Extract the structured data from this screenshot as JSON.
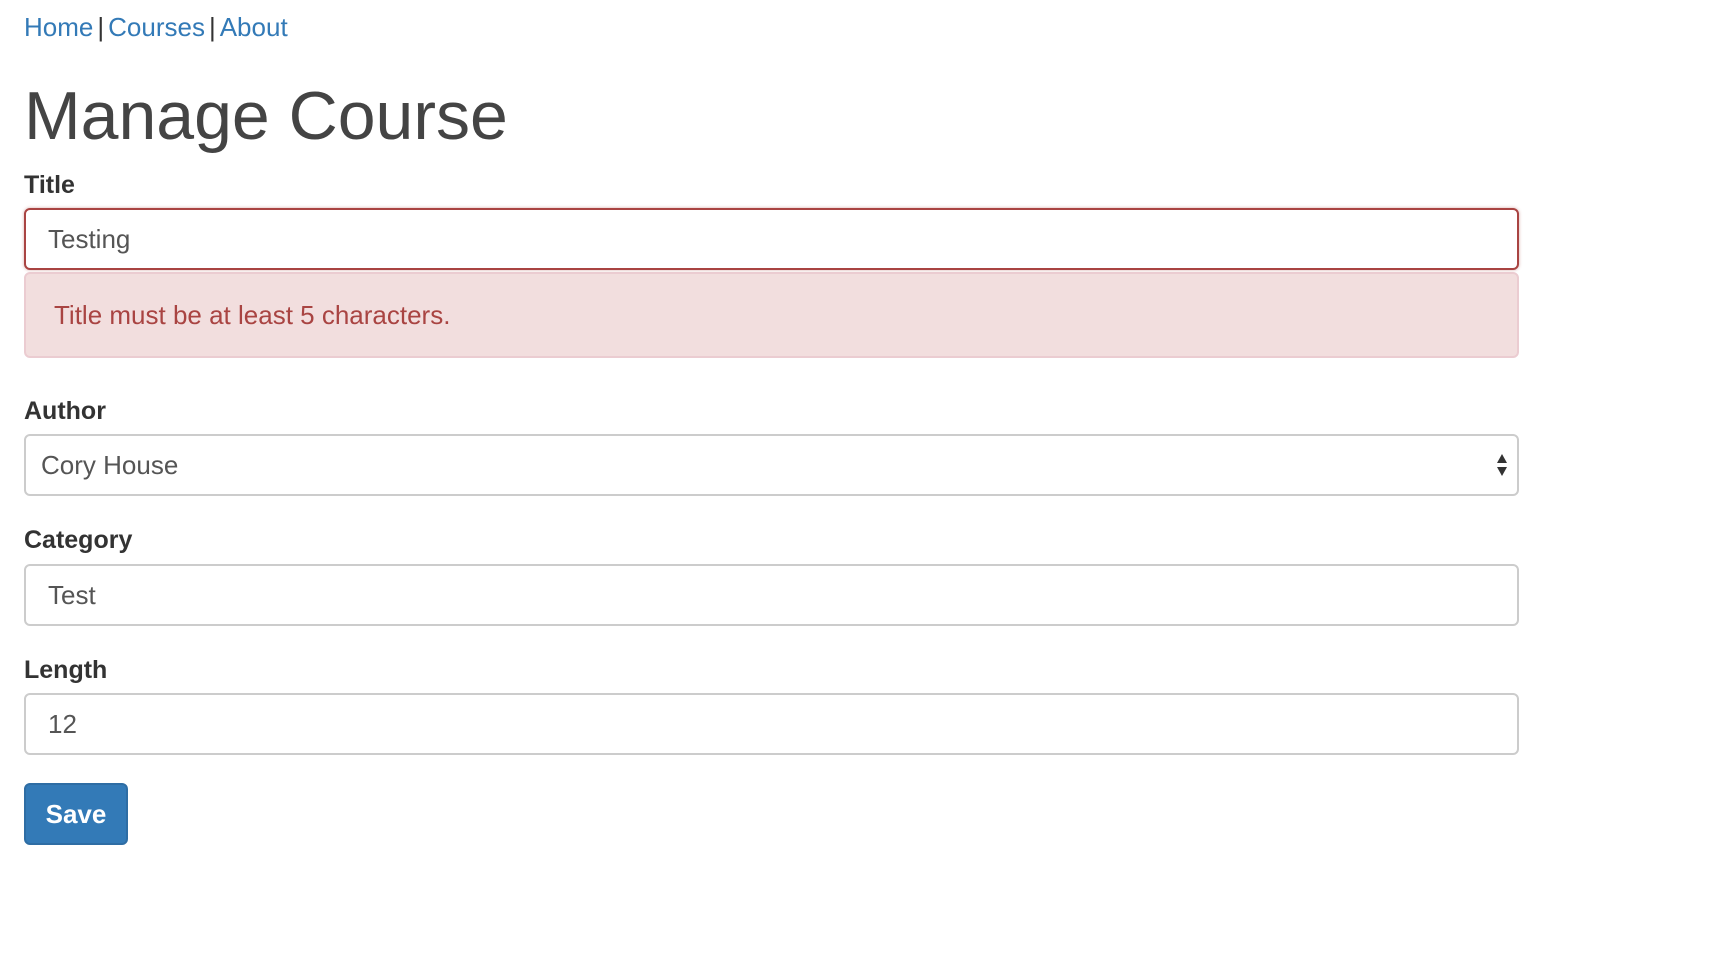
{
  "nav": {
    "items": [
      {
        "label": "Home"
      },
      {
        "label": "Courses"
      },
      {
        "label": "About"
      }
    ],
    "separator": "|"
  },
  "page": {
    "title": "Manage Course"
  },
  "form": {
    "title": {
      "label": "Title",
      "value": "Testing",
      "error": "Title must be at least 5 characters."
    },
    "author": {
      "label": "Author",
      "selected": "Cory House",
      "icon": "select-updown-arrows-icon"
    },
    "category": {
      "label": "Category",
      "value": "Test"
    },
    "length": {
      "label": "Length",
      "value": "12"
    },
    "save_label": "Save"
  },
  "colors": {
    "link": "#337ab7",
    "error_text": "#a94442",
    "error_bg": "#f2dede",
    "primary_button": "#337ab7"
  }
}
